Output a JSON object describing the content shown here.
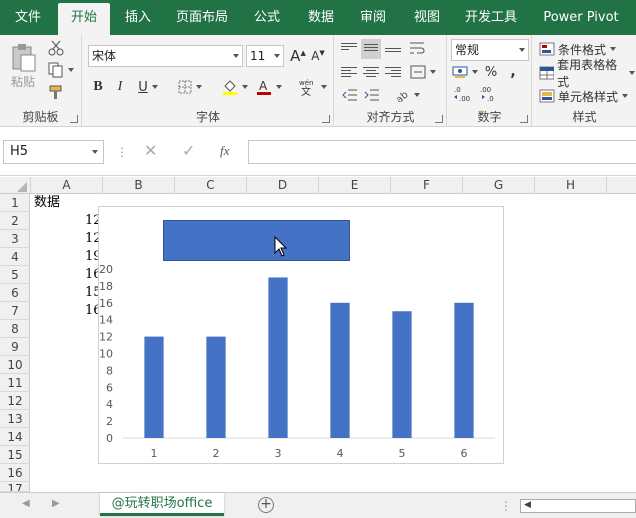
{
  "ribbon_tabs": [
    {
      "label": "文件"
    },
    {
      "label": "开始"
    },
    {
      "label": "插入"
    },
    {
      "label": "页面布局"
    },
    {
      "label": "公式"
    },
    {
      "label": "数据"
    },
    {
      "label": "审阅"
    },
    {
      "label": "视图"
    },
    {
      "label": "开发工具"
    },
    {
      "label": "Power Pivot"
    }
  ],
  "active_tab": "开始",
  "groups": {
    "clipboard": {
      "label": "剪贴板",
      "paste_label": "粘贴"
    },
    "font": {
      "label": "字体",
      "font_name": "宋体",
      "font_size": "11"
    },
    "alignment": {
      "label": "对齐方式"
    },
    "number": {
      "label": "数字",
      "format": "常规"
    },
    "styles": {
      "label": "样式",
      "conditional_format": "条件格式",
      "table_format": "套用表格格式",
      "cell_styles": "单元格样式"
    }
  },
  "formula_bar": {
    "name_box": "H5",
    "fx": "fx",
    "value": ""
  },
  "columns": [
    "A",
    "B",
    "C",
    "D",
    "E",
    "F",
    "G",
    "H"
  ],
  "rows": [
    "1",
    "2",
    "3",
    "4",
    "5",
    "6",
    "7",
    "8",
    "9",
    "10",
    "11",
    "12",
    "13",
    "14",
    "15",
    "16",
    "17"
  ],
  "cells": {
    "A1": "数据",
    "A_values": [
      "12",
      "12",
      "19",
      "16",
      "15",
      "16"
    ]
  },
  "chart_data": {
    "type": "bar",
    "categories": [
      "1",
      "2",
      "3",
      "4",
      "5",
      "6"
    ],
    "values": [
      12,
      12,
      19,
      16,
      15,
      16
    ],
    "title": "",
    "xlabel": "",
    "ylabel": "",
    "ylim": [
      0,
      20
    ],
    "yticks": [
      "0",
      "2",
      "4",
      "6",
      "8",
      "10",
      "12",
      "14",
      "16",
      "18",
      "20"
    ],
    "bar_color": "#4472c4",
    "grid": false
  },
  "sheet_tabs": [
    {
      "label": "@玩转职场office"
    }
  ],
  "colors": {
    "accent": "#217346",
    "series": "#4472c4"
  }
}
